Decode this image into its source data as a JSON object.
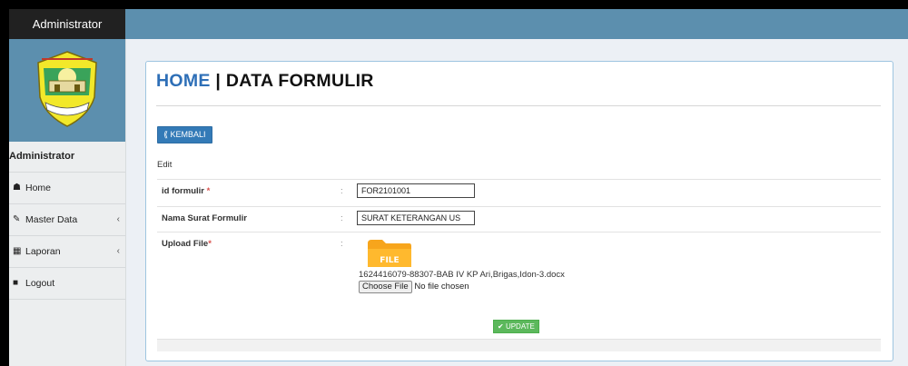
{
  "header": {
    "brand": "Administrator"
  },
  "sidebar": {
    "title": "Administrator",
    "items": [
      {
        "label": "Home",
        "icon": "home-icon",
        "caret": ""
      },
      {
        "label": "Master Data",
        "icon": "edit-icon",
        "caret": "‹"
      },
      {
        "label": "Laporan",
        "icon": "calendar-icon",
        "caret": "‹"
      },
      {
        "label": "Logout",
        "icon": "logout-icon",
        "caret": ""
      }
    ]
  },
  "main": {
    "title_home": "HOME",
    "title_sep": " | ",
    "title_rest": "DATA FORMULIR",
    "back_label": "KEMBALI",
    "edit_label": "Edit",
    "fields": {
      "id_label": "id formulir",
      "id_required": "*",
      "id_value": "FOR2101001",
      "nama_label": "Nama Surat Formulir",
      "nama_value": "SURAT KETERANGAN US",
      "upload_label": "Upload File",
      "upload_required": "*",
      "colon": ":",
      "folder_text": "FILE",
      "file_name": "1624416079-88307-BAB IV KP Ari,Brigas,Idon-3.docx",
      "choose_button": "Choose File",
      "no_file": "No file chosen"
    },
    "update_label": "UPDATE"
  },
  "colors": {
    "accent": "#5c8fae",
    "primary_button": "#337ab7",
    "success_button": "#5cb85c",
    "title_blue": "#2e6fb7"
  }
}
